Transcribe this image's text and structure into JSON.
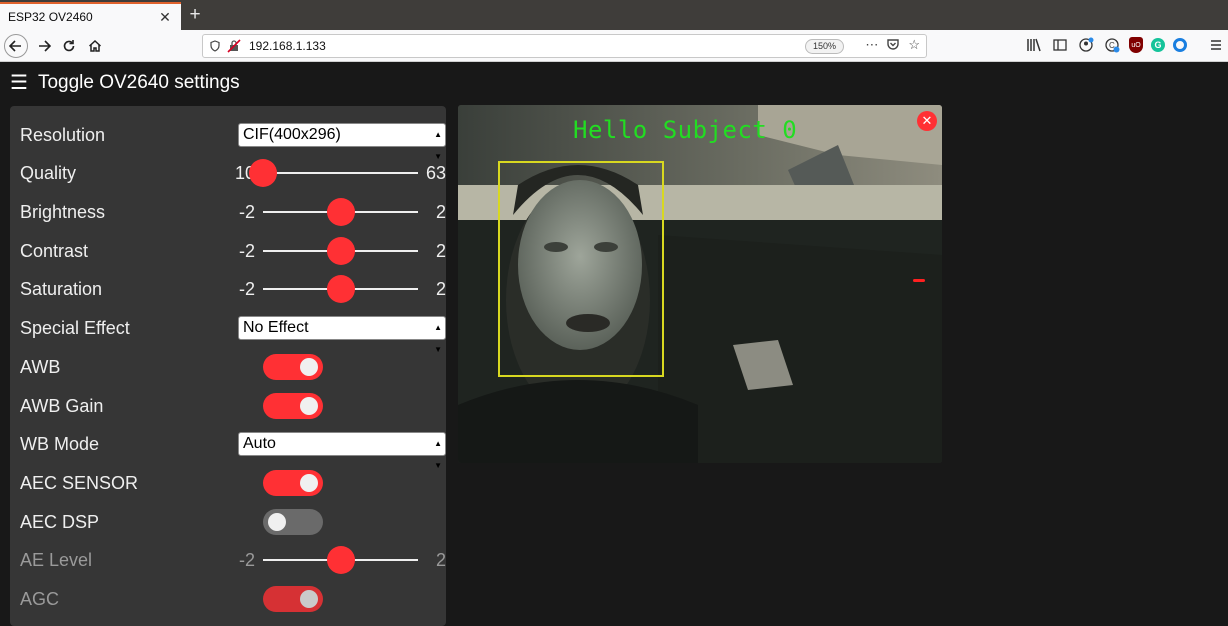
{
  "browser": {
    "tab_title": "ESP32 OV2460",
    "url": "192.168.1.133",
    "zoom": "150%"
  },
  "page": {
    "header": "Toggle OV2640 settings"
  },
  "settings": {
    "resolution": {
      "label": "Resolution",
      "value": "CIF(400x296)"
    },
    "quality": {
      "label": "Quality",
      "min": "10",
      "max": "63",
      "value": 10
    },
    "brightness": {
      "label": "Brightness",
      "min": "-2",
      "max": "2",
      "value": 0
    },
    "contrast": {
      "label": "Contrast",
      "min": "-2",
      "max": "2",
      "value": 0
    },
    "saturation": {
      "label": "Saturation",
      "min": "-2",
      "max": "2",
      "value": 0
    },
    "special_effect": {
      "label": "Special Effect",
      "value": "No Effect"
    },
    "awb": {
      "label": "AWB",
      "on": true
    },
    "awb_gain": {
      "label": "AWB Gain",
      "on": true
    },
    "wb_mode": {
      "label": "WB Mode",
      "value": "Auto"
    },
    "aec_sensor": {
      "label": "AEC SENSOR",
      "on": true
    },
    "aec_dsp": {
      "label": "AEC DSP",
      "on": false
    },
    "ae_level": {
      "label": "AE Level",
      "min": "-2",
      "max": "2",
      "value": 0
    },
    "agc": {
      "label": "AGC",
      "on": true
    }
  },
  "stream": {
    "caption": "Hello Subject 0",
    "close_glyph": "✕"
  },
  "colors": {
    "accent": "#ff3034",
    "panel": "#363636",
    "background": "#181818",
    "face_box": "#d8d820",
    "caption": "#22dd22"
  }
}
